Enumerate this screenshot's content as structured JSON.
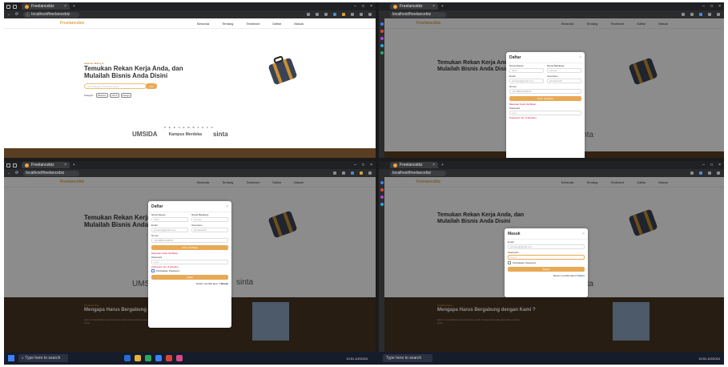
{
  "browser": {
    "tab_title": "Freelancebiz",
    "url": "localhost/freelancebiz",
    "url_prefix": "localhost"
  },
  "site": {
    "logo": "Freelancebiz",
    "menu": [
      "Beranda",
      "Tentang",
      "Testimoni",
      "Daftar",
      "Masuk"
    ],
    "hero_small": "Selamat datang di",
    "hero_title_1": "Temukan Rekan Kerja Anda, dan",
    "hero_title_2": "Mulailah Bisnis Anda Disini",
    "search_placeholder": "Cari kategori Freelance disini",
    "search_button": "Cari",
    "kategori_label": "Kategori :",
    "kategori": [
      "Website",
      "UI/UX",
      "Design"
    ],
    "partners_label": "P E R S E M B A H A N",
    "partners": [
      "UMSIDA",
      "Kampus Merdeka",
      "sinta"
    ],
    "lower_small": "Tentang Kami",
    "lower_title": "Mengapa Harus Bergabung dengan Kami ?",
    "lower_desc": "Kami memudahkan para freelance untuk menemukan pekerjaan dan pemberi kerja."
  },
  "daftar_modal": {
    "title": "Daftar",
    "close": "×",
    "nama_depan": "Nama Depan",
    "nama_depan_ph": "John",
    "nama_belakang": "Nama Belakang",
    "nama_belakang_ph": "Lennon",
    "email": "Email",
    "email_val": "johndoe@gmail.com",
    "username": "Username",
    "username_val": "johndoe123",
    "nomor": "Nomor",
    "kode": "+62",
    "nomor_val": "88812345678",
    "verif_button": "Kirim Verifikasi",
    "verif_note": "Masukan Kode Verifikasi",
    "password": "Password",
    "password_ph": "••••••",
    "pw_note": "Password min. 8 karakter",
    "checkbox": "Perlihatkan Password",
    "submit": "Daftar",
    "footer": "Sudah memiliki akun ?",
    "footer_link": "Masuk"
  },
  "masuk_modal": {
    "title": "Masuk",
    "close": "×",
    "email": "Email",
    "email_val": "johndoe@gmail.com",
    "password": "Password",
    "password_ph": "••••••••",
    "checkbox": "Perlihatkan Password",
    "submit": "Masuk",
    "footer": "Belum memiliki akun?",
    "footer_link": "Daftar"
  },
  "taskbar": {
    "search": "Type here to search",
    "time": "10:51",
    "date": "4/2/2024"
  }
}
